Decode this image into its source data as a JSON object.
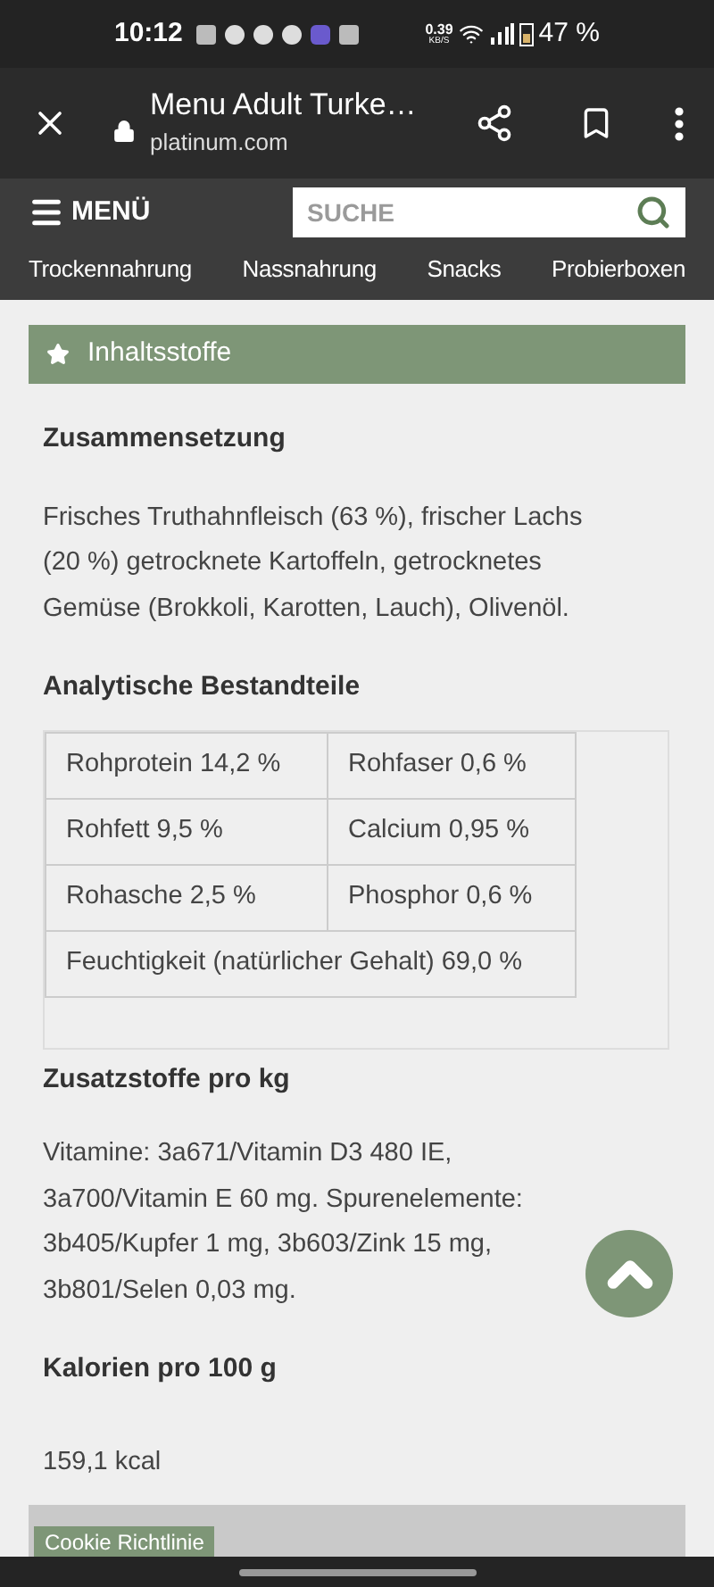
{
  "status_bar": {
    "time": "10:12",
    "network_speed": "0.39",
    "network_unit": "KB/S",
    "battery": "47 %"
  },
  "browser": {
    "title": "Menu Adult Turke…",
    "url": "platinum.com"
  },
  "site_header": {
    "menu_label": "MENÜ",
    "search": {
      "placeholder": "SUCHE"
    },
    "categories": [
      "Trockennahrung",
      "Nassnahrung",
      "Snacks",
      "Probierboxen"
    ]
  },
  "section": {
    "title": "Inhaltsstoffe",
    "composition_heading": "Zusammensetzung",
    "composition": "Frisches Truthahnfleisch (63 %), frischer Lachs (20 %) getrocknete Kartoffeln, getrocknetes Gemüse (Brokkoli, Karotten, Lauch), Olivenöl.",
    "analysis_heading": "Analytische Bestandteile",
    "analysis_rows": [
      [
        "Rohprotein 14,2 %",
        "Rohfaser 0,6 %"
      ],
      [
        "Rohfett 9,5 %",
        "Calcium 0,95 %"
      ],
      [
        "Rohasche 2,5 %",
        "Phosphor 0,6 %"
      ],
      [
        "Feuchtigkeit (natürlicher Gehalt) 69,0 %"
      ]
    ],
    "additives_heading": "Zusatzstoffe pro kg",
    "additives": "Vitamine: 3a671/Vitamin D3 480 IE, 3a700/Vitamin E 60 mg. Spurenelemente: 3b405/Kupfer 1 mg, 3b603/Zink 15 mg, 3b801/Selen 0,03 mg.",
    "calories_heading": "Kalorien pro 100 g",
    "calories": "159,1 kcal"
  },
  "cookie_banner": {
    "label": "Cookie Richtlinie"
  }
}
